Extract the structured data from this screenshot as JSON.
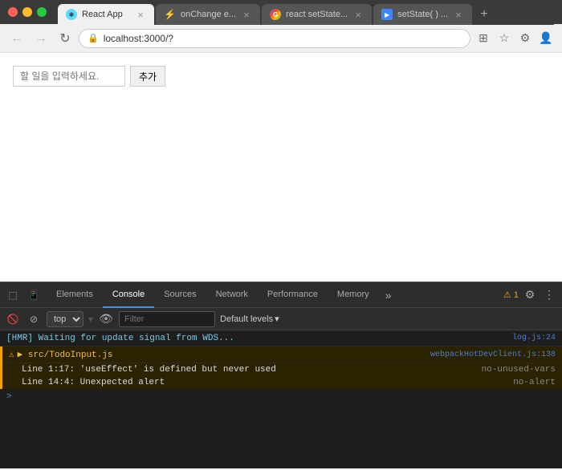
{
  "browser": {
    "title_bar": {
      "tabs": [
        {
          "id": "tab1",
          "label": "React App",
          "icon": "react",
          "active": true
        },
        {
          "id": "tab2",
          "label": "onChange e...",
          "icon": "lightning",
          "active": false
        },
        {
          "id": "tab3",
          "label": "react setState...",
          "icon": "google",
          "active": false
        },
        {
          "id": "tab4",
          "label": "setState( ) ...",
          "icon": "video",
          "active": false
        }
      ],
      "new_tab_label": "+"
    },
    "nav_bar": {
      "back_title": "Back",
      "forward_title": "Forward",
      "refresh_title": "Refresh",
      "address": "localhost:3000/?",
      "address_protocol": "🔒"
    }
  },
  "page": {
    "todo_placeholder": "할 일을 입력하세요.",
    "add_button_label": "추가"
  },
  "devtools": {
    "tabs": [
      {
        "id": "elements",
        "label": "Elements",
        "active": false
      },
      {
        "id": "console",
        "label": "Console",
        "active": true
      },
      {
        "id": "sources",
        "label": "Sources",
        "active": false
      },
      {
        "id": "network",
        "label": "Network",
        "active": false
      },
      {
        "id": "performance",
        "label": "Performance",
        "active": false
      },
      {
        "id": "memory",
        "label": "Memory",
        "active": false
      }
    ],
    "more_label": "»",
    "warning_count": "1",
    "console_toolbar": {
      "context_value": "top",
      "filter_placeholder": "Filter",
      "default_levels": "Default levels"
    },
    "console_lines": [
      {
        "id": "hmr",
        "text": "[HMR] Waiting for update signal from WDS...",
        "source": "log.js:24",
        "type": "info"
      },
      {
        "id": "warning-file",
        "text": "▶ src/TodoInput.js",
        "source": "webpackHotDevClient.js:138",
        "type": "warning-header"
      },
      {
        "id": "warning-line1",
        "indent": "    Line 1:17:  'useEffect' is defined but never used",
        "rule": "no-unused-vars",
        "type": "warning-detail"
      },
      {
        "id": "warning-line2",
        "indent": "    Line 14:4:  Unexpected alert",
        "rule": "no-alert",
        "type": "warning-detail"
      }
    ],
    "prompt": ">"
  }
}
